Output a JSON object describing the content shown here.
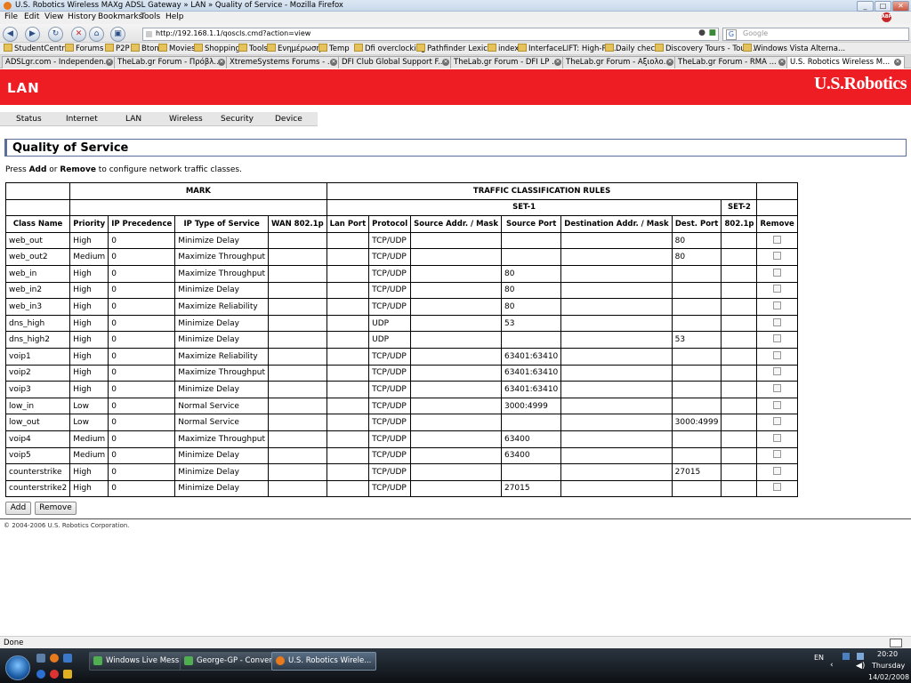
{
  "window": {
    "title": "U.S. Robotics Wireless MAXg ADSL Gateway » LAN » Quality of Service - Mozilla Firefox",
    "min": "_",
    "max": "□",
    "close": "✕"
  },
  "menu": [
    "File",
    "Edit",
    "View",
    "History",
    "Bookmarks",
    "Tools",
    "Help"
  ],
  "nav": {
    "url": "http://192.168.1.1/qoscls.cmd?action=view",
    "search_placeholder": "Google"
  },
  "bookmarks": [
    "StudentCentral",
    "Forums",
    "P2P",
    "Bton",
    "Movies",
    "Shopping",
    "Tools",
    "Ενημέρωση",
    "Temp",
    "Dfi overclocking",
    "Pathfinder Lexicon",
    "index",
    "InterfaceLIFT: High-Re...",
    "Daily check",
    "Discovery Tours - Tour...",
    "Windows Vista Alterna..."
  ],
  "tabs": [
    {
      "label": "ADSLgr.com - Independen..."
    },
    {
      "label": "TheLab.gr Forum - Πρόβλ..."
    },
    {
      "label": "XtremeSystems Forums - ..."
    },
    {
      "label": "DFI Club Global Support F..."
    },
    {
      "label": "TheLab.gr Forum - DFI LP ..."
    },
    {
      "label": "TheLab.gr Forum - Αξιολο..."
    },
    {
      "label": "TheLab.gr Forum - RMA ..."
    },
    {
      "label": "U.S. Robotics Wireless M..."
    }
  ],
  "banner": {
    "section": "LAN",
    "brand": "U.S.Robotics"
  },
  "router_nav": [
    "Status",
    "Internet",
    "LAN",
    "Wireless",
    "Security",
    "Device"
  ],
  "page": {
    "title": "Quality of Service",
    "instr_pre": "Press ",
    "instr_add": "Add",
    "instr_mid": " or ",
    "instr_remove": "Remove",
    "instr_post": " to configure network traffic classes."
  },
  "table": {
    "group_mark": "MARK",
    "group_rules": "TRAFFIC CLASSIFICATION RULES",
    "set1": "SET-1",
    "set2": "SET-2",
    "columns": [
      "Class Name",
      "Priority",
      "IP Precedence",
      "IP Type of Service",
      "WAN 802.1p",
      "Lan Port",
      "Protocol",
      "Source Addr. / Mask",
      "Source Port",
      "Destination Addr. / Mask",
      "Dest. Port",
      "802.1p",
      "Remove"
    ],
    "rows": [
      [
        "web_out",
        "High",
        "0",
        "Minimize Delay",
        "",
        "",
        "TCP/UDP",
        "",
        "",
        "",
        "80",
        ""
      ],
      [
        "web_out2",
        "Medium",
        "0",
        "Maximize Throughput",
        "",
        "",
        "TCP/UDP",
        "",
        "",
        "",
        "80",
        ""
      ],
      [
        "web_in",
        "High",
        "0",
        "Maximize Throughput",
        "",
        "",
        "TCP/UDP",
        "",
        "80",
        "",
        "",
        ""
      ],
      [
        "web_in2",
        "High",
        "0",
        "Minimize Delay",
        "",
        "",
        "TCP/UDP",
        "",
        "80",
        "",
        "",
        ""
      ],
      [
        "web_in3",
        "High",
        "0",
        "Maximize Reliability",
        "",
        "",
        "TCP/UDP",
        "",
        "80",
        "",
        "",
        ""
      ],
      [
        "dns_high",
        "High",
        "0",
        "Minimize Delay",
        "",
        "",
        "UDP",
        "",
        "53",
        "",
        "",
        ""
      ],
      [
        "dns_high2",
        "High",
        "0",
        "Minimize Delay",
        "",
        "",
        "UDP",
        "",
        "",
        "",
        "53",
        ""
      ],
      [
        "voip1",
        "High",
        "0",
        "Maximize Reliability",
        "",
        "",
        "TCP/UDP",
        "",
        "63401:63410",
        "",
        "",
        ""
      ],
      [
        "voip2",
        "High",
        "0",
        "Maximize Throughput",
        "",
        "",
        "TCP/UDP",
        "",
        "63401:63410",
        "",
        "",
        ""
      ],
      [
        "voip3",
        "High",
        "0",
        "Minimize Delay",
        "",
        "",
        "TCP/UDP",
        "",
        "63401:63410",
        "",
        "",
        ""
      ],
      [
        "low_in",
        "Low",
        "0",
        "Normal Service",
        "",
        "",
        "TCP/UDP",
        "",
        "3000:4999",
        "",
        "",
        ""
      ],
      [
        "low_out",
        "Low",
        "0",
        "Normal Service",
        "",
        "",
        "TCP/UDP",
        "",
        "",
        "",
        "3000:4999",
        ""
      ],
      [
        "voip4",
        "Medium",
        "0",
        "Maximize Throughput",
        "",
        "",
        "TCP/UDP",
        "",
        "63400",
        "",
        "",
        ""
      ],
      [
        "voip5",
        "Medium",
        "0",
        "Minimize Delay",
        "",
        "",
        "TCP/UDP",
        "",
        "63400",
        "",
        "",
        ""
      ],
      [
        "counterstrike",
        "High",
        "0",
        "Minimize Delay",
        "",
        "",
        "TCP/UDP",
        "",
        "",
        "",
        "27015",
        ""
      ],
      [
        "counterstrike2",
        "High",
        "0",
        "Minimize Delay",
        "",
        "",
        "TCP/UDP",
        "",
        "27015",
        "",
        "",
        ""
      ]
    ]
  },
  "buttons": {
    "add": "Add",
    "remove": "Remove"
  },
  "footer": "© 2004-2006 U.S. Robotics Corporation.",
  "status": "Done",
  "taskbar": {
    "items": [
      "Windows Live Mess...",
      "George-GP - Conver...",
      "U.S. Robotics Wirele..."
    ],
    "lang": "EN",
    "time": "20:20",
    "day": "Thursday",
    "date": "14/02/2008"
  },
  "colors": {
    "banner": "#ee1c23",
    "section_border": "#5a6e99"
  }
}
